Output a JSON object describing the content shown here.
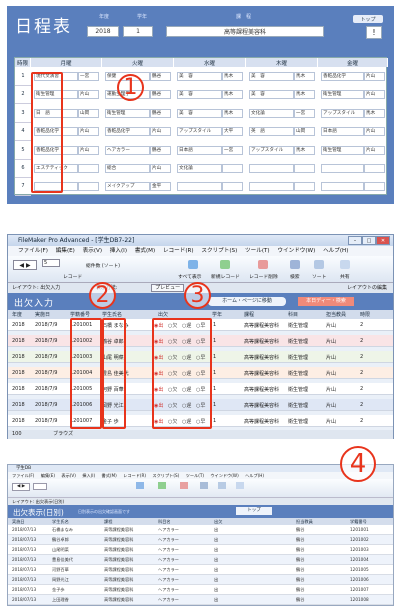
{
  "panel1": {
    "title": "日程表",
    "labels": {
      "year": "年度",
      "grade": "学年",
      "course": "課　程"
    },
    "year": "2018",
    "grade": "1",
    "course": "高等課程美容科",
    "top_button": "トップ",
    "close_button": "!",
    "period_header": "時限",
    "days": [
      "月曜",
      "火曜",
      "水曜",
      "木曜",
      "金曜"
    ],
    "periods": [
      "1",
      "2",
      "3",
      "4",
      "5",
      "6",
      "7"
    ],
    "monday": [
      [
        "現代文演習",
        "一宮"
      ],
      [
        "衛生管理",
        "片山"
      ],
      [
        "日　語",
        "山岡"
      ],
      [
        "香粧品化学",
        "片山"
      ],
      [
        "香粧品化学",
        "片山"
      ],
      [
        "エステティック",
        ""
      ],
      [
        "",
        ""
      ]
    ],
    "tuesday": [
      [
        "保健",
        "鶴谷"
      ],
      [
        "運動生理学",
        "鶴谷"
      ],
      [
        "衛生管理",
        "鶴谷"
      ],
      [
        "香粧品化学",
        "片山"
      ],
      [
        "ヘアカラー",
        "鶴谷"
      ],
      [
        "総合",
        "片山"
      ],
      [
        "メイクアップ",
        "金平"
      ]
    ],
    "wednesday": [
      [
        "美　容",
        "馬木"
      ],
      [
        "美　容",
        "馬木"
      ],
      [
        "美　容",
        "馬木"
      ],
      [
        "アップスタイル",
        "大平"
      ],
      [
        "日本語",
        "一宮"
      ],
      [
        "文化論",
        ""
      ],
      [
        "",
        ""
      ]
    ],
    "thursday": [
      [
        "美　容",
        "馬木"
      ],
      [
        "美　容",
        "馬木"
      ],
      [
        "文化論",
        "一宮"
      ],
      [
        "英　語",
        "山岡"
      ],
      [
        "アップスタイル",
        "馬木"
      ],
      [
        "",
        ""
      ],
      [
        "",
        ""
      ]
    ],
    "friday": [
      [
        "香粧品化学",
        "片山"
      ],
      [
        "衛生管理",
        "片山"
      ],
      [
        "アップスタイル",
        "馬木"
      ],
      [
        "日本語",
        "片山"
      ],
      [
        "衛生管理",
        "片山"
      ],
      [
        "",
        ""
      ],
      [
        "",
        ""
      ]
    ],
    "marker": "1"
  },
  "panel2": {
    "window_title": "FileMaker Pro Advanced - [学生DB7-22]",
    "menu": [
      "ファイル(F)",
      "編集(E)",
      "表示(V)",
      "挿入(I)",
      "書式(M)",
      "レコード(R)",
      "スクリプト(S)",
      "ツール(T)",
      "ウインドウ(W)",
      "ヘルプ(H)"
    ],
    "record_label": "レコード",
    "record_count": "総件数 (ソート)",
    "toolbar_items": [
      "すべて表示",
      "新規レコード",
      "レコード削除",
      "検索",
      "ソート",
      "共有"
    ],
    "layout_label": "レイアウト: 出欠入力",
    "view_label": "表示方法:",
    "preview_button": "プレビュー",
    "edit_layout": "レイアウトの編集",
    "header_title": "出欠入力",
    "home_button": "ホーム・ページに移動",
    "today_button": "本日ディー・検索",
    "columns": [
      "年度",
      "実施日",
      "学籍番号",
      "学生氏名",
      "出欠",
      "学年",
      "課程",
      "科目",
      "担当教員",
      "時限"
    ],
    "rows": [
      [
        "2018",
        "2018/7/9",
        "1201001",
        "石橋 まなみ",
        "1",
        "高等課程美容科",
        "衛生管理",
        "片山",
        "2"
      ],
      [
        "2018",
        "2018/7/9",
        "1201002",
        "鶴谷 卓郎",
        "1",
        "高等課程美容科",
        "衛生管理",
        "片山",
        "2"
      ],
      [
        "2018",
        "2018/7/9",
        "1201003",
        "山尾 明菜",
        "1",
        "高等課程美容科",
        "衛生管理",
        "片山",
        "2"
      ],
      [
        "2018",
        "2018/7/9",
        "1201004",
        "豊島 佳美代",
        "1",
        "高等課程美容科",
        "衛生管理",
        "片山",
        "2"
      ],
      [
        "2018",
        "2018/7/9",
        "1201005",
        "河野 百華",
        "1",
        "高等課程美容科",
        "衛生管理",
        "片山",
        "2"
      ],
      [
        "2018",
        "2018/7/9",
        "1201006",
        "岡野 光江",
        "1",
        "高等課程美容科",
        "衛生管理",
        "片山",
        "2"
      ],
      [
        "2018",
        "2018/7/9",
        "1201007",
        "金子 歩",
        "1",
        "高等課程美容科",
        "衛生管理",
        "片山",
        "2"
      ]
    ],
    "attendance_options": [
      "出",
      "欠",
      "遅",
      "早"
    ],
    "status_zoom": "100",
    "status_mode": "ブラウズ",
    "markers": [
      "2",
      "3"
    ]
  },
  "panel3": {
    "window_title": "学生DB",
    "menu": [
      "ファイル(F)",
      "編集(E)",
      "表示(V)",
      "挿入(I)",
      "書式(M)",
      "レコード(R)",
      "スクリプト(S)",
      "ツール(T)",
      "ウインドウ(W)",
      "ヘルプ(H)"
    ],
    "layout_label": "レイアウト: 出欠表示(日別)",
    "header_title": "出欠表示(日別)",
    "header_note": "日別表示の出欠確認画面です",
    "top_button": "トップ",
    "columns": [
      "実施日",
      "学生氏名",
      "課程",
      "科目名",
      "出欠",
      "担当教員",
      "学籍番号"
    ],
    "rows": [
      [
        "2018/07/13",
        "石橋まなみ",
        "高等課程美容科",
        "ヘアカラー",
        "出",
        "鶴谷",
        "1201001"
      ],
      [
        "2018/07/13",
        "鶴谷卓郎",
        "高等課程美容科",
        "ヘアカラー",
        "出",
        "鶴谷",
        "1201002"
      ],
      [
        "2018/07/13",
        "山尾明菜",
        "高等課程美容科",
        "ヘアカラー",
        "出",
        "鶴谷",
        "1201003"
      ],
      [
        "2018/07/13",
        "豊島佳美代",
        "高等課程美容科",
        "ヘアカラー",
        "出",
        "鶴谷",
        "1201004"
      ],
      [
        "2018/07/13",
        "河野百華",
        "高等課程美容科",
        "ヘアカラー",
        "出",
        "鶴谷",
        "1201005"
      ],
      [
        "2018/07/13",
        "岡野光江",
        "高等課程美容科",
        "ヘアカラー",
        "出",
        "鶴谷",
        "1201006"
      ],
      [
        "2018/07/13",
        "金子歩",
        "高等課程美容科",
        "ヘアカラー",
        "出",
        "鶴谷",
        "1201007"
      ],
      [
        "2018/07/13",
        "上田理香",
        "高等課程美容科",
        "ヘアカラー",
        "出",
        "鶴谷",
        "1201008"
      ]
    ],
    "marker": "4"
  }
}
